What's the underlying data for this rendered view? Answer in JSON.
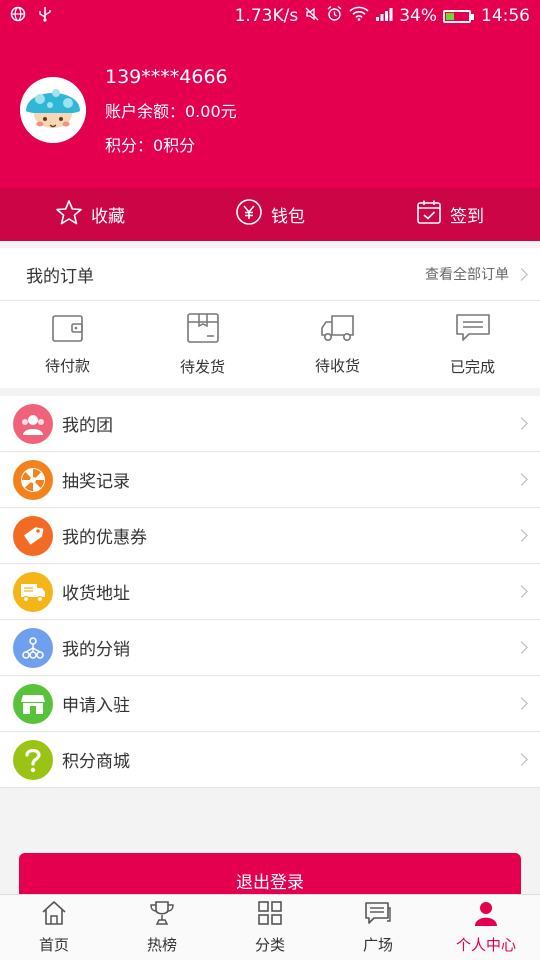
{
  "status_bar": {
    "speed": "1.73K/s",
    "battery": "34%",
    "battery_level": 0.34,
    "time": "14:56"
  },
  "profile": {
    "phone": "139****4666",
    "balance": "账户余额：0.00元",
    "points": "积分：0积分"
  },
  "quick_actions": {
    "favorites": "收藏",
    "wallet": "钱包",
    "checkin": "签到"
  },
  "orders": {
    "title": "我的订单",
    "view_all": "查看全部订单",
    "items": [
      "待付款",
      "待发货",
      "待收货",
      "已完成"
    ]
  },
  "menu": [
    {
      "label": "我的团",
      "color": "#f0627a",
      "icon": "group-icon"
    },
    {
      "label": "抽奖记录",
      "color": "#f3821c",
      "icon": "lottery-wheel-icon"
    },
    {
      "label": "我的优惠券",
      "color": "#f36a24",
      "icon": "coupon-tag-icon"
    },
    {
      "label": "收货地址",
      "color": "#f5b417",
      "icon": "delivery-truck-icon"
    },
    {
      "label": "我的分销",
      "color": "#6fa0ee",
      "icon": "distribution-icon"
    },
    {
      "label": "申请入驻",
      "color": "#58c23b",
      "icon": "store-icon"
    },
    {
      "label": "积分商城",
      "color": "#9ac414",
      "icon": "question-icon"
    }
  ],
  "logout": "退出登录",
  "tabs": [
    "首页",
    "热榜",
    "分类",
    "广场",
    "个人中心"
  ],
  "colors": {
    "brand": "#e5004f",
    "brand_dark": "#cc0646"
  }
}
